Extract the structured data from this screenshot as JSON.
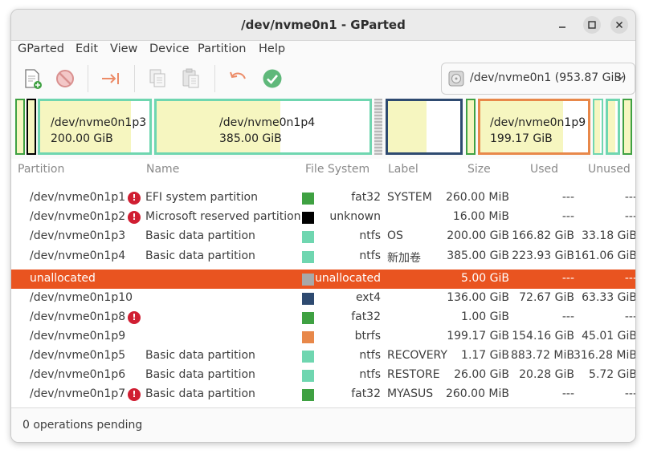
{
  "window": {
    "title": "/dev/nvme0n1 - GParted"
  },
  "menu": [
    "GParted",
    "Edit",
    "View",
    "Device",
    "Partition",
    "Help"
  ],
  "toolbar": {
    "buttons": [
      "new-partition-icon",
      "delete-icon",
      "resize-move-icon",
      "copy-icon",
      "paste-icon",
      "undo-icon",
      "apply-icon"
    ],
    "device_selector": "/dev/nvme0n1 (953.87 GiB)"
  },
  "disk_map": [
    {
      "type": "fat32",
      "used_fraction": 1.0
    },
    {
      "type": "unknown",
      "used_fraction": 1.0
    },
    {
      "label_line1": "/dev/nvme0n1p3",
      "label_line2": "200.00 GiB",
      "type": "ntfs",
      "used_fraction": 0.83
    },
    {
      "label_line1": "/dev/nvme0n1p4",
      "label_line2": "385.00 GiB",
      "type": "ntfs",
      "used_fraction": 0.58
    },
    {
      "type": "unallocated"
    },
    {
      "type": "ext4",
      "used_fraction": 0.53
    },
    {
      "type": "fat32",
      "used_fraction": 1.0
    },
    {
      "label_line1": "/dev/nvme0n1p9",
      "label_line2": "199.17 GiB",
      "type": "btrfs",
      "used_fraction": 0.77
    },
    {
      "type": "ntfs",
      "used_fraction": 0.74
    },
    {
      "type": "ntfs",
      "used_fraction": 0.78
    },
    {
      "type": "fat32",
      "used_fraction": 1.0
    }
  ],
  "columns": [
    "Partition",
    "Name",
    "File System",
    "Label",
    "Size",
    "Used",
    "Unused"
  ],
  "colors": {
    "fat32": "#3fa142",
    "unknown": "#000000",
    "ntfs": "#6fd6b0",
    "unallocated": "#a8a8a8",
    "ext4": "#2e4a70",
    "btrfs": "#e8884a",
    "selection": "#e95420"
  },
  "rows": [
    {
      "partition": "/dev/nvme0n1p1",
      "warn": true,
      "name": "EFI system partition",
      "fs": "fat32",
      "label": "SYSTEM",
      "size": "260.00 MiB",
      "used": "---",
      "unused": "---"
    },
    {
      "partition": "/dev/nvme0n1p2",
      "warn": true,
      "name": "Microsoft reserved partition",
      "fs": "unknown",
      "label": "",
      "size": "16.00 MiB",
      "used": "---",
      "unused": "---"
    },
    {
      "partition": "/dev/nvme0n1p3",
      "warn": false,
      "name": "Basic data partition",
      "fs": "ntfs",
      "label": "OS",
      "size": "200.00 GiB",
      "used": "166.82 GiB",
      "unused": "33.18 GiB"
    },
    {
      "partition": "/dev/nvme0n1p4",
      "warn": false,
      "name": "Basic data partition",
      "fs": "ntfs",
      "label": "新加卷",
      "size": "385.00 GiB",
      "used": "223.93 GiB",
      "unused": "161.06 GiB"
    },
    {
      "partition": "unallocated",
      "warn": false,
      "name": "",
      "fs": "unallocated",
      "label": "",
      "size": "5.00 GiB",
      "used": "---",
      "unused": "---",
      "selected": true
    },
    {
      "partition": "/dev/nvme0n1p10",
      "warn": false,
      "name": "",
      "fs": "ext4",
      "label": "",
      "size": "136.00 GiB",
      "used": "72.67 GiB",
      "unused": "63.33 GiB"
    },
    {
      "partition": "/dev/nvme0n1p8",
      "warn": true,
      "name": "",
      "fs": "fat32",
      "label": "",
      "size": "1.00 GiB",
      "used": "---",
      "unused": "---"
    },
    {
      "partition": "/dev/nvme0n1p9",
      "warn": false,
      "name": "",
      "fs": "btrfs",
      "label": "",
      "size": "199.17 GiB",
      "used": "154.16 GiB",
      "unused": "45.01 GiB"
    },
    {
      "partition": "/dev/nvme0n1p5",
      "warn": false,
      "name": "Basic data partition",
      "fs": "ntfs",
      "label": "RECOVERY",
      "size": "1.17 GiB",
      "used": "883.72 MiB",
      "unused": "316.28 MiB"
    },
    {
      "partition": "/dev/nvme0n1p6",
      "warn": false,
      "name": "Basic data partition",
      "fs": "ntfs",
      "label": "RESTORE",
      "size": "26.00 GiB",
      "used": "20.28 GiB",
      "unused": "5.72 GiB"
    },
    {
      "partition": "/dev/nvme0n1p7",
      "warn": true,
      "name": "Basic data partition",
      "fs": "fat32",
      "label": "MYASUS",
      "size": "260.00 MiB",
      "used": "---",
      "unused": "---"
    }
  ],
  "status": "0 operations pending"
}
